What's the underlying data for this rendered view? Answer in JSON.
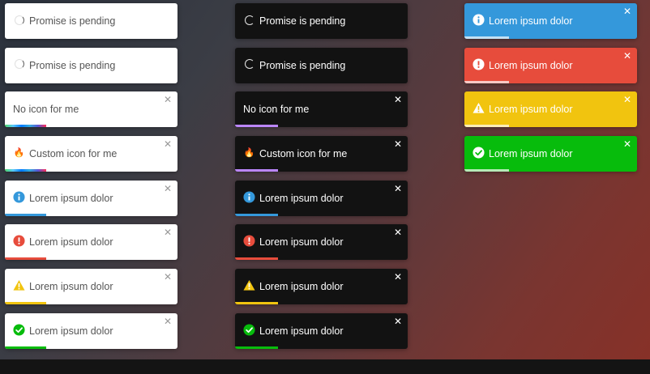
{
  "texts": {
    "pending": "Promise is pending",
    "no_icon": "No icon for me",
    "custom_icon": "Custom icon for me",
    "lorem": "Lorem ipsum dolor",
    "close": "✕",
    "fire": "🔥"
  },
  "colors": {
    "info": "#3498db",
    "error": "#e74c3c",
    "warning": "#f1c40f",
    "success": "#07bc0c",
    "rainbow": "linear-gradient(to right,#4cd964,#5ac8fa,#007aff,#34aadc,#5856d6,#ff2d55)",
    "dark_default": "#bb86fc"
  },
  "columns": [
    {
      "theme": "light",
      "toasts": [
        {
          "kind": "pending",
          "text": "Promise is pending",
          "icon": "spinner-icon"
        },
        {
          "kind": "pending",
          "text": "Promise is pending",
          "icon": "spinner-icon"
        },
        {
          "kind": "default",
          "text": "No icon for me",
          "icon": "none",
          "close": true,
          "progress": 0.24
        },
        {
          "kind": "default",
          "text": "Custom icon for me",
          "icon": "fire-icon",
          "close": true,
          "progress": 0.24
        },
        {
          "kind": "info",
          "text": "Lorem ipsum dolor",
          "icon": "info-icon",
          "close": true,
          "progress": 0.24
        },
        {
          "kind": "error",
          "text": "Lorem ipsum dolor",
          "icon": "error-icon",
          "close": true,
          "progress": 0.24
        },
        {
          "kind": "warning",
          "text": "Lorem ipsum dolor",
          "icon": "warning-icon",
          "close": true,
          "progress": 0.24
        },
        {
          "kind": "success",
          "text": "Lorem ipsum dolor",
          "icon": "success-icon",
          "close": true,
          "progress": 0.24
        }
      ]
    },
    {
      "theme": "dark",
      "toasts": [
        {
          "kind": "pending",
          "text": "Promise is pending",
          "icon": "spinner-icon"
        },
        {
          "kind": "pending",
          "text": "Promise is pending",
          "icon": "spinner-icon"
        },
        {
          "kind": "default",
          "text": "No icon for me",
          "icon": "none",
          "close": true,
          "progress": 0.25
        },
        {
          "kind": "default",
          "text": "Custom icon for me",
          "icon": "fire-icon",
          "close": true,
          "progress": 0.25
        },
        {
          "kind": "info",
          "text": "Lorem ipsum dolor",
          "icon": "info-icon",
          "close": true,
          "progress": 0.25
        },
        {
          "kind": "error",
          "text": "Lorem ipsum dolor",
          "icon": "error-icon",
          "close": true,
          "progress": 0.25
        },
        {
          "kind": "warning",
          "text": "Lorem ipsum dolor",
          "icon": "warning-icon",
          "close": true,
          "progress": 0.25
        },
        {
          "kind": "success",
          "text": "Lorem ipsum dolor",
          "icon": "success-icon",
          "close": true,
          "progress": 0.25
        }
      ]
    },
    {
      "theme": "colored",
      "toasts": [
        {
          "kind": "info",
          "text": "Lorem ipsum dolor",
          "icon": "info-icon",
          "close": true,
          "progress": 0.26
        },
        {
          "kind": "error",
          "text": "Lorem ipsum dolor",
          "icon": "error-icon",
          "close": true,
          "progress": 0.26
        },
        {
          "kind": "warning",
          "text": "Lorem ipsum dolor",
          "icon": "warning-icon",
          "close": true,
          "progress": 0.26
        },
        {
          "kind": "success",
          "text": "Lorem ipsum dolor",
          "icon": "success-icon",
          "close": true,
          "progress": 0.26
        }
      ]
    }
  ]
}
